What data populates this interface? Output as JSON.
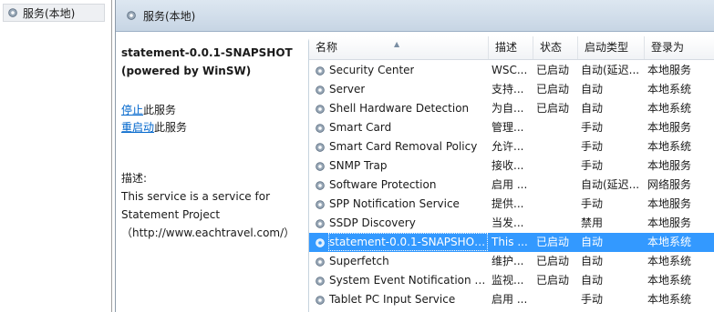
{
  "tree": {
    "label": "服务(本地)",
    "icon": "services-gear-icon"
  },
  "header": {
    "title": "服务(本地)",
    "icon": "services-gear-icon"
  },
  "detail": {
    "service_name": "statement-0.0.1-SNAPSHOT",
    "powered": "(powered by WinSW)",
    "stop_link": "停止",
    "stop_suffix": "此服务",
    "restart_link": "重启动",
    "restart_suffix": "此服务",
    "desc_label": "描述:",
    "desc_line1": "This service is a service for",
    "desc_line2": "Statement Project",
    "desc_line3": "（http://www.eachtravel.com/）"
  },
  "columns": {
    "name": "名称",
    "desc": "描述",
    "status": "状态",
    "start": "启动类型",
    "logon": "登录为"
  },
  "services": [
    {
      "name": "Security Center",
      "desc": "WSC...",
      "status": "已启动",
      "start": "自动(延迟...",
      "logon": "本地服务"
    },
    {
      "name": "Server",
      "desc": "支持...",
      "status": "已启动",
      "start": "自动",
      "logon": "本地系统"
    },
    {
      "name": "Shell Hardware Detection",
      "desc": "为自...",
      "status": "已启动",
      "start": "自动",
      "logon": "本地系统"
    },
    {
      "name": "Smart Card",
      "desc": "管理...",
      "status": "",
      "start": "手动",
      "logon": "本地服务"
    },
    {
      "name": "Smart Card Removal Policy",
      "desc": "允许...",
      "status": "",
      "start": "手动",
      "logon": "本地系统"
    },
    {
      "name": "SNMP Trap",
      "desc": "接收...",
      "status": "",
      "start": "手动",
      "logon": "本地服务"
    },
    {
      "name": "Software Protection",
      "desc": "启用 ...",
      "status": "",
      "start": "自动(延迟...",
      "logon": "网络服务"
    },
    {
      "name": "SPP Notification Service",
      "desc": "提供...",
      "status": "",
      "start": "手动",
      "logon": "本地服务"
    },
    {
      "name": "SSDP Discovery",
      "desc": "当发...",
      "status": "",
      "start": "禁用",
      "logon": "本地服务"
    },
    {
      "name": "statement-0.0.1-SNAPSHOT...",
      "desc": "This ...",
      "status": "已启动",
      "start": "自动",
      "logon": "本地系统",
      "selected": true
    },
    {
      "name": "Superfetch",
      "desc": "维护...",
      "status": "已启动",
      "start": "自动",
      "logon": "本地系统"
    },
    {
      "name": "System Event Notification S...",
      "desc": "监视...",
      "status": "已启动",
      "start": "自动",
      "logon": "本地系统"
    },
    {
      "name": "Tablet PC Input Service",
      "desc": "启用 ...",
      "status": "",
      "start": "手动",
      "logon": "本地系统"
    }
  ],
  "colors": {
    "selection": "#3399ff",
    "link": "#0066cc",
    "header_bg": "#c7d5e4"
  }
}
